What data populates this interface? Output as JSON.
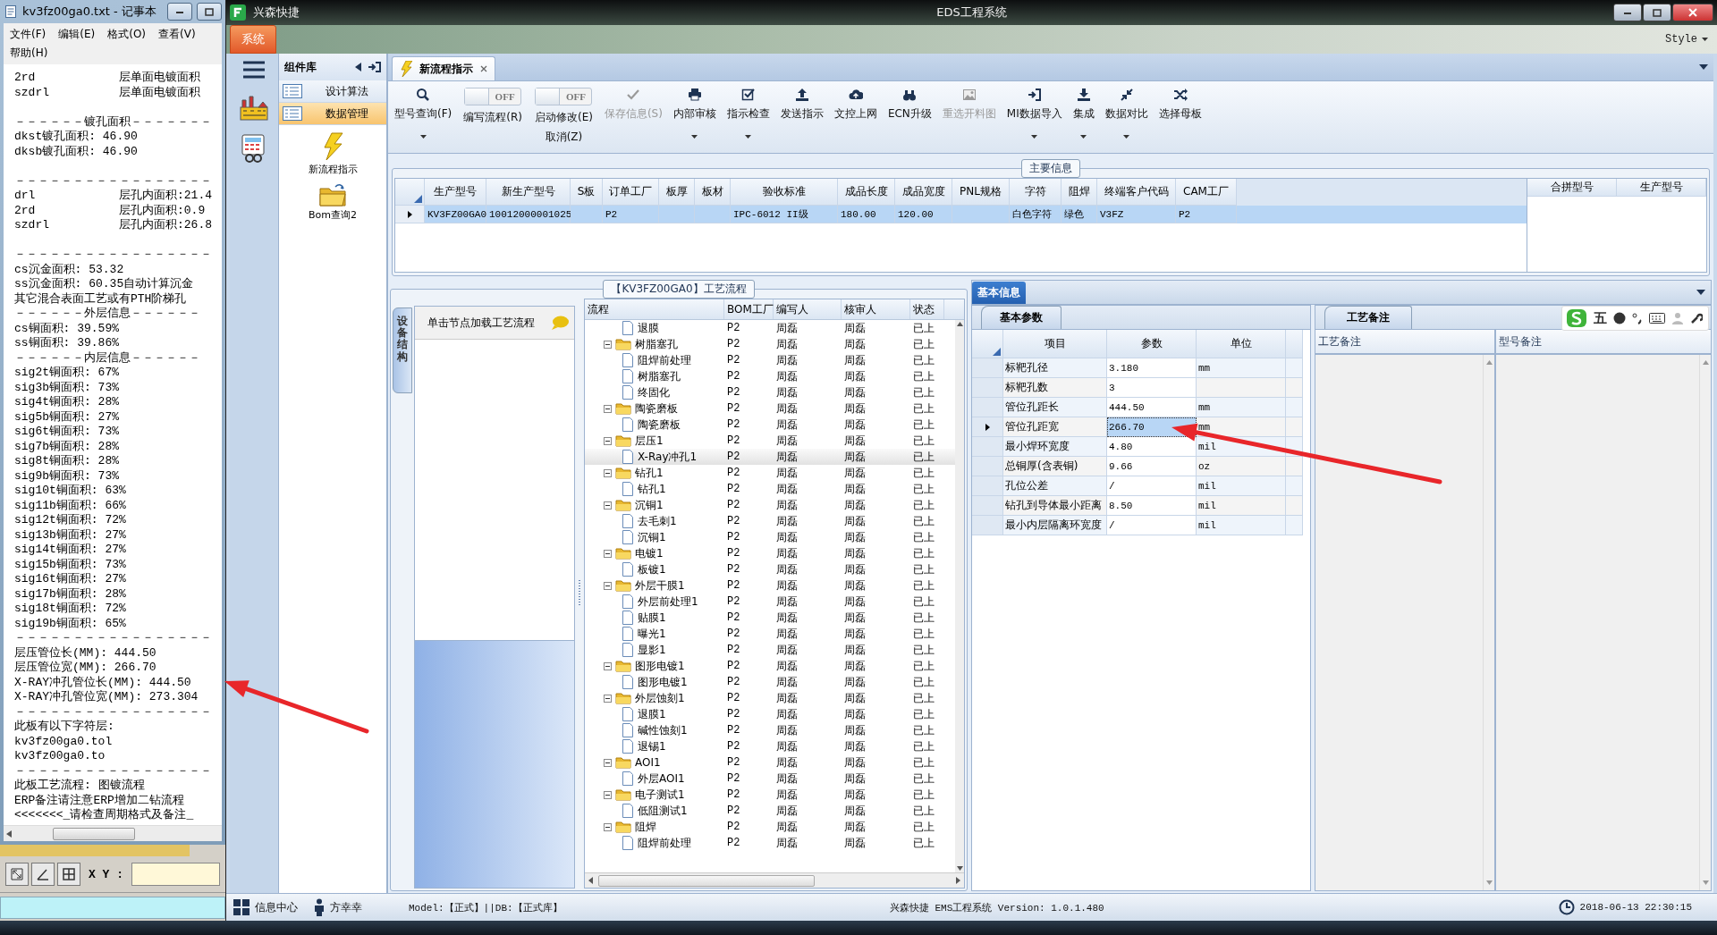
{
  "notepad": {
    "title": "kv3fz00ga0.txt - 记事本",
    "menu": [
      "文件(F)",
      "编辑(E)",
      "格式(O)",
      "查看(V)",
      "帮助(H)"
    ],
    "blocks": [
      [
        "2rd            层单面电镀面积",
        "szdrl          层单面电镀面积"
      ],
      [
        "－－－－－－镀孔面积－－－－－－－",
        "dkst镀孔面积: 46.90",
        "dksb镀孔面积: 46.90"
      ],
      [
        "－－－－－－－－－－－－－－－－－",
        "drl            层孔内面积:21.4",
        "2rd            层孔内面积:0.9",
        "szdrl          层孔内面积:26.8"
      ],
      [
        "－－－－－－－－－－－－－－－－－",
        "cs沉金面积: 53.32",
        "ss沉金面积: 60.35自动计算沉金",
        "其它混合表面工艺或有PTH阶梯孔",
        "－－－－－－外层信息－－－－－－",
        "cs铜面积: 39.59%",
        "ss铜面积: 39.86%",
        "－－－－－－内层信息－－－－－－",
        "sig2t铜面积: 67%",
        "sig3b铜面积: 73%",
        "sig4t铜面积: 28%",
        "sig5b铜面积: 27%",
        "sig6t铜面积: 73%",
        "sig7b铜面积: 28%",
        "sig8t铜面积: 28%",
        "sig9b铜面积: 73%",
        "sig10t铜面积: 63%",
        "sig11b铜面积: 66%",
        "sig12t铜面积: 72%",
        "sig13b铜面积: 27%",
        "sig14t铜面积: 27%",
        "sig15b铜面积: 73%",
        "sig16t铜面积: 27%",
        "sig17b铜面积: 28%",
        "sig18t铜面积: 72%",
        "sig19b铜面积: 65%",
        "－－－－－－－－－－－－－－－－－",
        "层压管位长(MM): 444.50",
        "层压管位宽(MM): 266.70",
        "X-RAY冲孔管位长(MM): 444.50",
        "X-RAY冲孔管位宽(MM): 273.304",
        "－－－－－－－－－－－－－－－－－",
        "此板有以下字符层:",
        "kv3fz00ga0.tol",
        "kv3fz00ga0.to",
        "－－－－－－－－－－－－－－－－－",
        "此板工艺流程: 图镀流程",
        "ERP备注请注意ERP增加二钻流程",
        "<<<<<<<_请检查周期格式及备注_"
      ]
    ]
  },
  "cad_toolbar": {
    "label": "X Y :"
  },
  "app": {
    "name": "兴森快捷",
    "title": "EDS工程系统",
    "system_button": "系统",
    "style_menu": "Style"
  },
  "component_panel": {
    "title": "组件库",
    "items": [
      {
        "label": "设计算法",
        "selected": false
      },
      {
        "label": "数据管理",
        "selected": true
      }
    ],
    "shortcuts": [
      {
        "label": "新流程指示",
        "kind": "bolt"
      },
      {
        "label": "Bom查询2",
        "kind": "folder"
      }
    ]
  },
  "tabs": [
    {
      "label": "新流程指示",
      "selected": true
    }
  ],
  "toolbar": [
    {
      "kind": "button",
      "label": "型号查询(F)",
      "dropdown": true,
      "disabled": false
    },
    {
      "kind": "toggle",
      "state_label": "OFF",
      "on": false,
      "label": "编写流程(R)"
    },
    {
      "kind": "toggle",
      "state_label": "OFF",
      "on": false,
      "label": "启动修改(E)",
      "sublabel": "取消(Z)"
    },
    {
      "kind": "button",
      "label": "保存信息(S)",
      "dropdown": false,
      "disabled": true
    },
    {
      "kind": "button",
      "label": "内部审核",
      "dropdown": true,
      "disabled": false
    },
    {
      "kind": "button",
      "label": "指示检查",
      "dropdown": true,
      "disabled": false
    },
    {
      "kind": "button",
      "label": "发送指示",
      "dropdown": false,
      "disabled": false
    },
    {
      "kind": "button",
      "label": "文控上网",
      "dropdown": false,
      "disabled": false
    },
    {
      "kind": "button",
      "label": "ECN升级",
      "dropdown": false,
      "disabled": false
    },
    {
      "kind": "button",
      "label": "重选开料图",
      "dropdown": false,
      "disabled": true
    },
    {
      "kind": "button",
      "label": "MI数据导入",
      "dropdown": true,
      "disabled": false
    },
    {
      "kind": "button",
      "label": "集成",
      "dropdown": true,
      "disabled": false
    },
    {
      "kind": "button",
      "label": "数据对比",
      "dropdown": true,
      "disabled": false
    },
    {
      "kind": "button",
      "label": "选择母板",
      "dropdown": false,
      "disabled": false
    }
  ],
  "main_info": {
    "title": "主要信息",
    "columns": [
      "生产型号",
      "新生产型号",
      "S板",
      "订单工厂",
      "板厚",
      "板材",
      "验收标准",
      "成品长度",
      "成品宽度",
      "PNL规格",
      "字符",
      "阻焊",
      "终端客户代码",
      "CAM工厂"
    ],
    "rows": [
      {
        "selected": true,
        "cells": [
          "KV3FZ00GA0",
          "10012000001025",
          null,
          "P2",
          null,
          null,
          "IPC-6012 II级",
          "180.00",
          "120.00",
          null,
          "白色字符",
          "绿色",
          "V3FZ",
          "P2"
        ]
      }
    ],
    "side_columns": [
      "合拼型号",
      "生产型号"
    ]
  },
  "flow": {
    "title": "【KV3FZ00GA0】工艺流程",
    "side_tab": "设备结构",
    "hint": "单击节点加载工艺流程",
    "columns": [
      "流程",
      "BOM工厂",
      "编写人",
      "核审人",
      "状态"
    ],
    "nodes": [
      {
        "kind": "step",
        "name": "退膜",
        "factory": "P2",
        "writer": "周磊",
        "reviewer": "周磊",
        "status": "已上",
        "selected": false
      },
      {
        "kind": "group",
        "name": "树脂塞孔",
        "factory": "P2",
        "writer": "周磊",
        "reviewer": "周磊",
        "status": "已上",
        "selected": false,
        "expanded": true,
        "children": [
          {
            "kind": "step",
            "name": "阻焊前处理",
            "factory": "P2",
            "writer": "周磊",
            "reviewer": "周磊",
            "status": "已上",
            "selected": false
          },
          {
            "kind": "step",
            "name": "树脂塞孔",
            "factory": "P2",
            "writer": "周磊",
            "reviewer": "周磊",
            "status": "已上",
            "selected": false
          },
          {
            "kind": "step",
            "name": "终固化",
            "factory": "P2",
            "writer": "周磊",
            "reviewer": "周磊",
            "status": "已上",
            "selected": false
          }
        ]
      },
      {
        "kind": "group",
        "name": "陶瓷磨板",
        "factory": "P2",
        "writer": "周磊",
        "reviewer": "周磊",
        "status": "已上",
        "selected": false,
        "expanded": true,
        "children": [
          {
            "kind": "step",
            "name": "陶瓷磨板",
            "factory": "P2",
            "writer": "周磊",
            "reviewer": "周磊",
            "status": "已上",
            "selected": false
          }
        ]
      },
      {
        "kind": "group",
        "name": "层压1",
        "factory": "P2",
        "writer": "周磊",
        "reviewer": "周磊",
        "status": "已上",
        "selected": false,
        "expanded": true,
        "children": [
          {
            "kind": "step",
            "name": "X-Ray冲孔1",
            "factory": "P2",
            "writer": "周磊",
            "reviewer": "周磊",
            "status": "已上",
            "selected": true
          }
        ]
      },
      {
        "kind": "group",
        "name": "钻孔1",
        "factory": "P2",
        "writer": "周磊",
        "reviewer": "周磊",
        "status": "已上",
        "selected": false,
        "expanded": true,
        "children": [
          {
            "kind": "step",
            "name": "钻孔1",
            "factory": "P2",
            "writer": "周磊",
            "reviewer": "周磊",
            "status": "已上",
            "selected": false
          }
        ]
      },
      {
        "kind": "group",
        "name": "沉铜1",
        "factory": "P2",
        "writer": "周磊",
        "reviewer": "周磊",
        "status": "已上",
        "selected": false,
        "expanded": true,
        "children": [
          {
            "kind": "step",
            "name": "去毛刺1",
            "factory": "P2",
            "writer": "周磊",
            "reviewer": "周磊",
            "status": "已上",
            "selected": false
          },
          {
            "kind": "step",
            "name": "沉铜1",
            "factory": "P2",
            "writer": "周磊",
            "reviewer": "周磊",
            "status": "已上",
            "selected": false
          }
        ]
      },
      {
        "kind": "group",
        "name": "电镀1",
        "factory": "P2",
        "writer": "周磊",
        "reviewer": "周磊",
        "status": "已上",
        "selected": false,
        "expanded": true,
        "children": [
          {
            "kind": "step",
            "name": "板镀1",
            "factory": "P2",
            "writer": "周磊",
            "reviewer": "周磊",
            "status": "已上",
            "selected": false
          }
        ]
      },
      {
        "kind": "group",
        "name": "外层干膜1",
        "factory": "P2",
        "writer": "周磊",
        "reviewer": "周磊",
        "status": "已上",
        "selected": false,
        "expanded": true,
        "children": [
          {
            "kind": "step",
            "name": "外层前处理1",
            "factory": "P2",
            "writer": "周磊",
            "reviewer": "周磊",
            "status": "已上",
            "selected": false
          },
          {
            "kind": "step",
            "name": "贴膜1",
            "factory": "P2",
            "writer": "周磊",
            "reviewer": "周磊",
            "status": "已上",
            "selected": false
          },
          {
            "kind": "step",
            "name": "曝光1",
            "factory": "P2",
            "writer": "周磊",
            "reviewer": "周磊",
            "status": "已上",
            "selected": false
          },
          {
            "kind": "step",
            "name": "显影1",
            "factory": "P2",
            "writer": "周磊",
            "reviewer": "周磊",
            "status": "已上",
            "selected": false
          }
        ]
      },
      {
        "kind": "group",
        "name": "图形电镀1",
        "factory": "P2",
        "writer": "周磊",
        "reviewer": "周磊",
        "status": "已上",
        "selected": false,
        "expanded": true,
        "children": [
          {
            "kind": "step",
            "name": "图形电镀1",
            "factory": "P2",
            "writer": "周磊",
            "reviewer": "周磊",
            "status": "已上",
            "selected": false
          }
        ]
      },
      {
        "kind": "group",
        "name": "外层蚀刻1",
        "factory": "P2",
        "writer": "周磊",
        "reviewer": "周磊",
        "status": "已上",
        "selected": false,
        "expanded": true,
        "children": [
          {
            "kind": "step",
            "name": "退膜1",
            "factory": "P2",
            "writer": "周磊",
            "reviewer": "周磊",
            "status": "已上",
            "selected": false
          },
          {
            "kind": "step",
            "name": "碱性蚀刻1",
            "factory": "P2",
            "writer": "周磊",
            "reviewer": "周磊",
            "status": "已上",
            "selected": false
          },
          {
            "kind": "step",
            "name": "退锡1",
            "factory": "P2",
            "writer": "周磊",
            "reviewer": "周磊",
            "status": "已上",
            "selected": false
          }
        ]
      },
      {
        "kind": "group",
        "name": "AOI1",
        "factory": "P2",
        "writer": "周磊",
        "reviewer": "周磊",
        "status": "已上",
        "selected": false,
        "expanded": true,
        "children": [
          {
            "kind": "step",
            "name": "外层AOI1",
            "factory": "P2",
            "writer": "周磊",
            "reviewer": "周磊",
            "status": "已上",
            "selected": false
          }
        ]
      },
      {
        "kind": "group",
        "name": "电子测试1",
        "factory": "P2",
        "writer": "周磊",
        "reviewer": "周磊",
        "status": "已上",
        "selected": false,
        "expanded": true,
        "children": [
          {
            "kind": "step",
            "name": "低阻测试1",
            "factory": "P2",
            "writer": "周磊",
            "reviewer": "周磊",
            "status": "已上",
            "selected": false
          }
        ]
      },
      {
        "kind": "group",
        "name": "阻焊",
        "factory": "P2",
        "writer": "周磊",
        "reviewer": "周磊",
        "status": "已上",
        "selected": false,
        "expanded": true,
        "children": [
          {
            "kind": "step",
            "name": "阻焊前处理",
            "factory": "P2",
            "writer": "周磊",
            "reviewer": "周磊",
            "status": "已上",
            "selected": false
          }
        ]
      }
    ]
  },
  "basic_info": {
    "header_tab": "基本信息",
    "tab": "基本参数",
    "columns": [
      "项目",
      "参数",
      "单位"
    ],
    "rows": [
      {
        "item": "标靶孔径",
        "value": "3.180",
        "unit": "mm",
        "selected": false
      },
      {
        "item": "标靶孔数",
        "value": "3",
        "selected": false
      },
      {
        "item": "管位孔距长",
        "value": "444.50",
        "unit": "mm",
        "selected": false
      },
      {
        "item": "管位孔距宽",
        "value": "266.70",
        "unit": "mm",
        "selected": true
      },
      {
        "item": "最小焊环宽度",
        "value": "4.80",
        "unit": "mil",
        "selected": false
      },
      {
        "item": "总铜厚(含表铜)",
        "value": "9.66",
        "unit": "oz",
        "selected": false
      },
      {
        "item": "孔位公差",
        "value": "/",
        "unit": "mil",
        "selected": false
      },
      {
        "item": "钻孔到导体最小距离",
        "value": "8.50",
        "unit": "mil",
        "selected": false
      },
      {
        "item": "最小内层隔离环宽度",
        "value": "/",
        "unit": "mil",
        "selected": false
      }
    ]
  },
  "remarks": {
    "tab": "工艺备注",
    "columns": [
      "工艺备注",
      "型号备注"
    ]
  },
  "ime_toolbar": {
    "mode": "五"
  },
  "status_bar": {
    "info_center": "信息中心",
    "user": "方幸幸",
    "model": "Model:【正式】||DB:【正式库】",
    "version": "兴森快捷 EMS工程系统 Version: 1.0.1.480",
    "time": "2018-06-13 22:30:15"
  },
  "annotations": [
    {
      "kind": "arrow"
    },
    {
      "kind": "arrow"
    }
  ]
}
